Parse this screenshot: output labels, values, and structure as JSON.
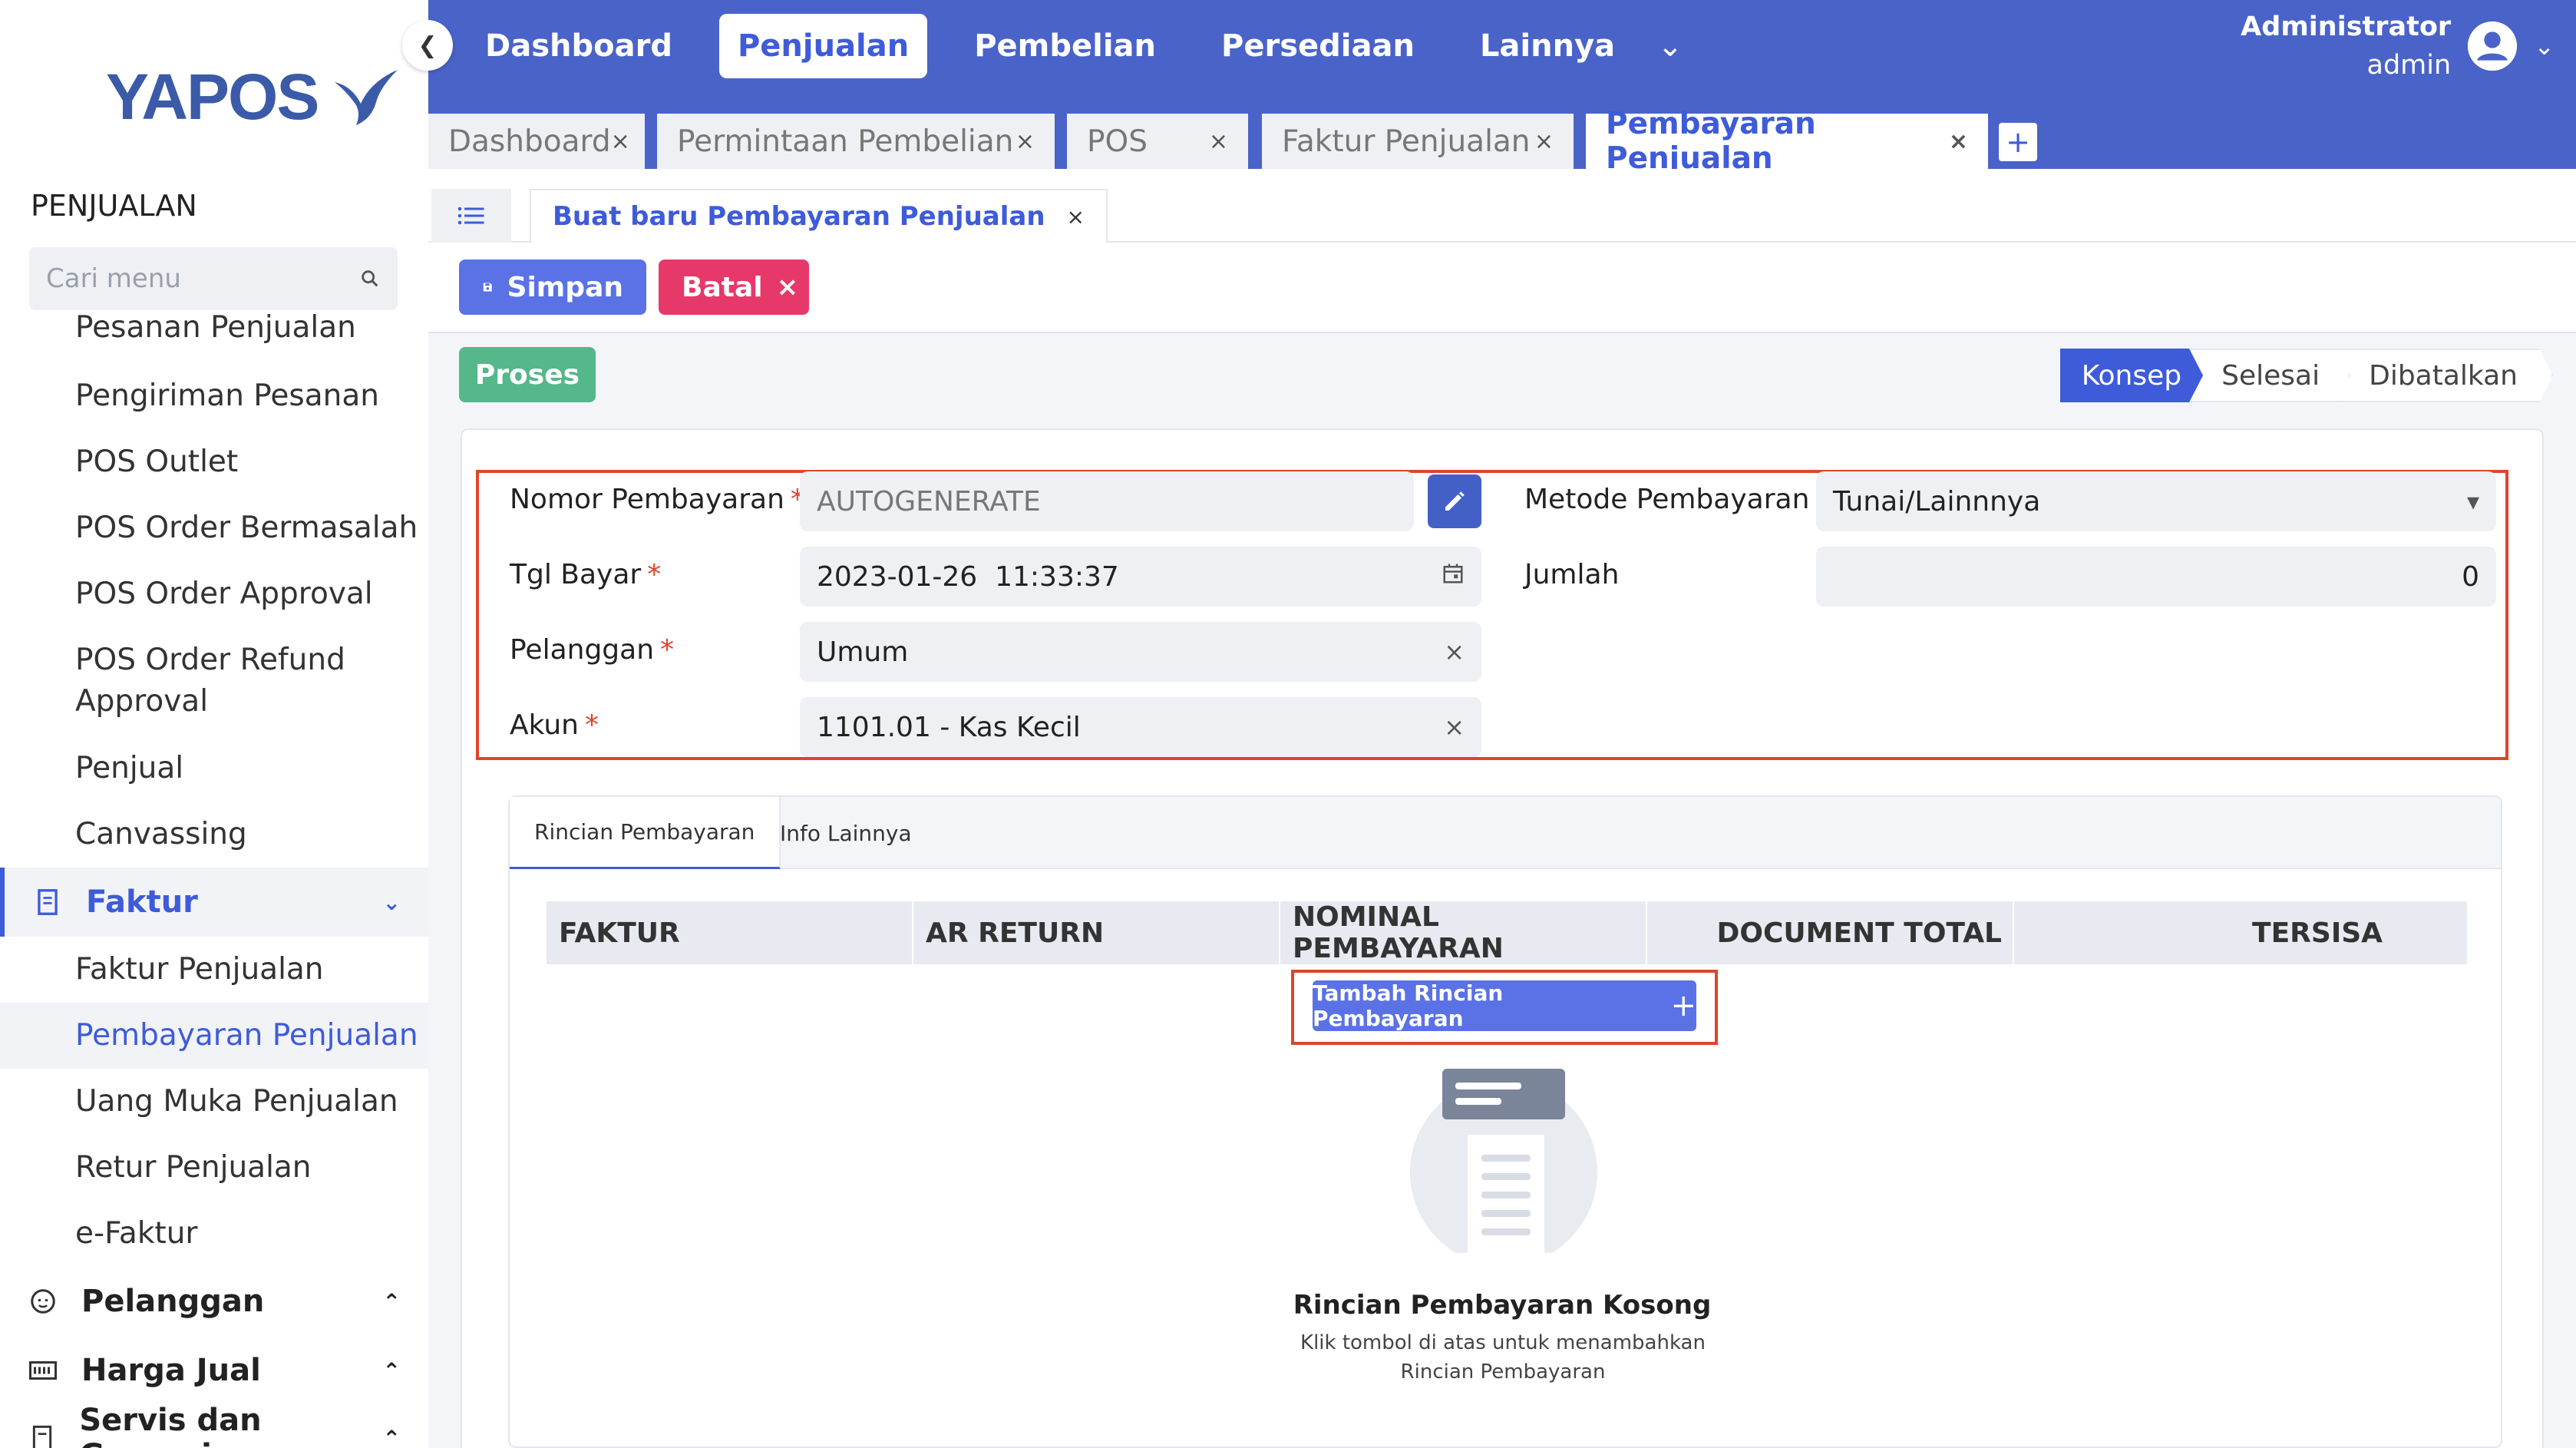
{
  "app": {
    "logo_text": "YAPOS",
    "colors": {
      "primary": "#4a63c9",
      "accent": "#3e5bd9",
      "danger": "#e6396a",
      "success": "#55b88a",
      "highlight": "#e0442a"
    }
  },
  "sidebar": {
    "section_title": "PENJUALAN",
    "search_placeholder": "Cari menu",
    "items_top": [
      "Pesanan Penjualan",
      "Pengiriman Pesanan",
      "POS Outlet",
      "POS Order Bermasalah",
      "POS Order Approval",
      "POS Order Refund Approval",
      "Penjual",
      "Canvassing"
    ],
    "faktur_group": {
      "label": "Faktur",
      "icon": "receipt-icon",
      "children": [
        "Faktur Penjualan",
        "Pembayaran Penjualan",
        "Uang Muka Penjualan",
        "Retur Penjualan",
        "e-Faktur"
      ]
    },
    "groups_bottom": [
      {
        "label": "Pelanggan",
        "icon": "customer-icon"
      },
      {
        "label": "Harga Jual",
        "icon": "price-icon"
      },
      {
        "label": "Servis dan Garansi",
        "icon": "service-icon"
      }
    ]
  },
  "header": {
    "nav": [
      "Dashboard",
      "Penjualan",
      "Pembelian",
      "Persediaan",
      "Lainnya"
    ],
    "active_nav": "Penjualan",
    "user_name": "Administrator",
    "user_role": "admin"
  },
  "tabs": [
    {
      "label": "Dashboard"
    },
    {
      "label": "Permintaan Pembelian"
    },
    {
      "label": "POS"
    },
    {
      "label": "Faktur Penjualan"
    },
    {
      "label": "Pembayaran Penjualan"
    }
  ],
  "subtab": {
    "label": "Buat baru Pembayaran Penjualan"
  },
  "actions": {
    "save": "Simpan",
    "cancel": "Batal",
    "process": "Proses"
  },
  "status_steps": [
    "Konsep",
    "Selesai",
    "Dibatalkan"
  ],
  "form": {
    "nomor_label": "Nomor Pembayaran",
    "nomor_placeholder": "AUTOGENERATE",
    "tgl_label": "Tgl Bayar",
    "tgl_value": "2023-01-26  11:33:37",
    "pelanggan_label": "Pelanggan",
    "pelanggan_value": "Umum",
    "akun_label": "Akun",
    "akun_value": "1101.01 - Kas Kecil",
    "metode_label": "Metode Pembayaran",
    "metode_value": "Tunai/Lainnnya",
    "jumlah_label": "Jumlah",
    "jumlah_value": "0",
    "required_mark": "*"
  },
  "detail": {
    "tabs": [
      "Rincian Pembayaran",
      "Info Lainnya"
    ],
    "columns": [
      "FAKTUR",
      "AR RETURN",
      "NOMINAL PEMBAYARAN",
      "DOCUMENT TOTAL",
      "TERSISA"
    ],
    "add_button": "Tambah Rincian Pembayaran",
    "empty_title": "Rincian Pembayaran Kosong",
    "empty_desc": "Klik tombol di atas untuk menambahkan Rincian Pembayaran"
  }
}
